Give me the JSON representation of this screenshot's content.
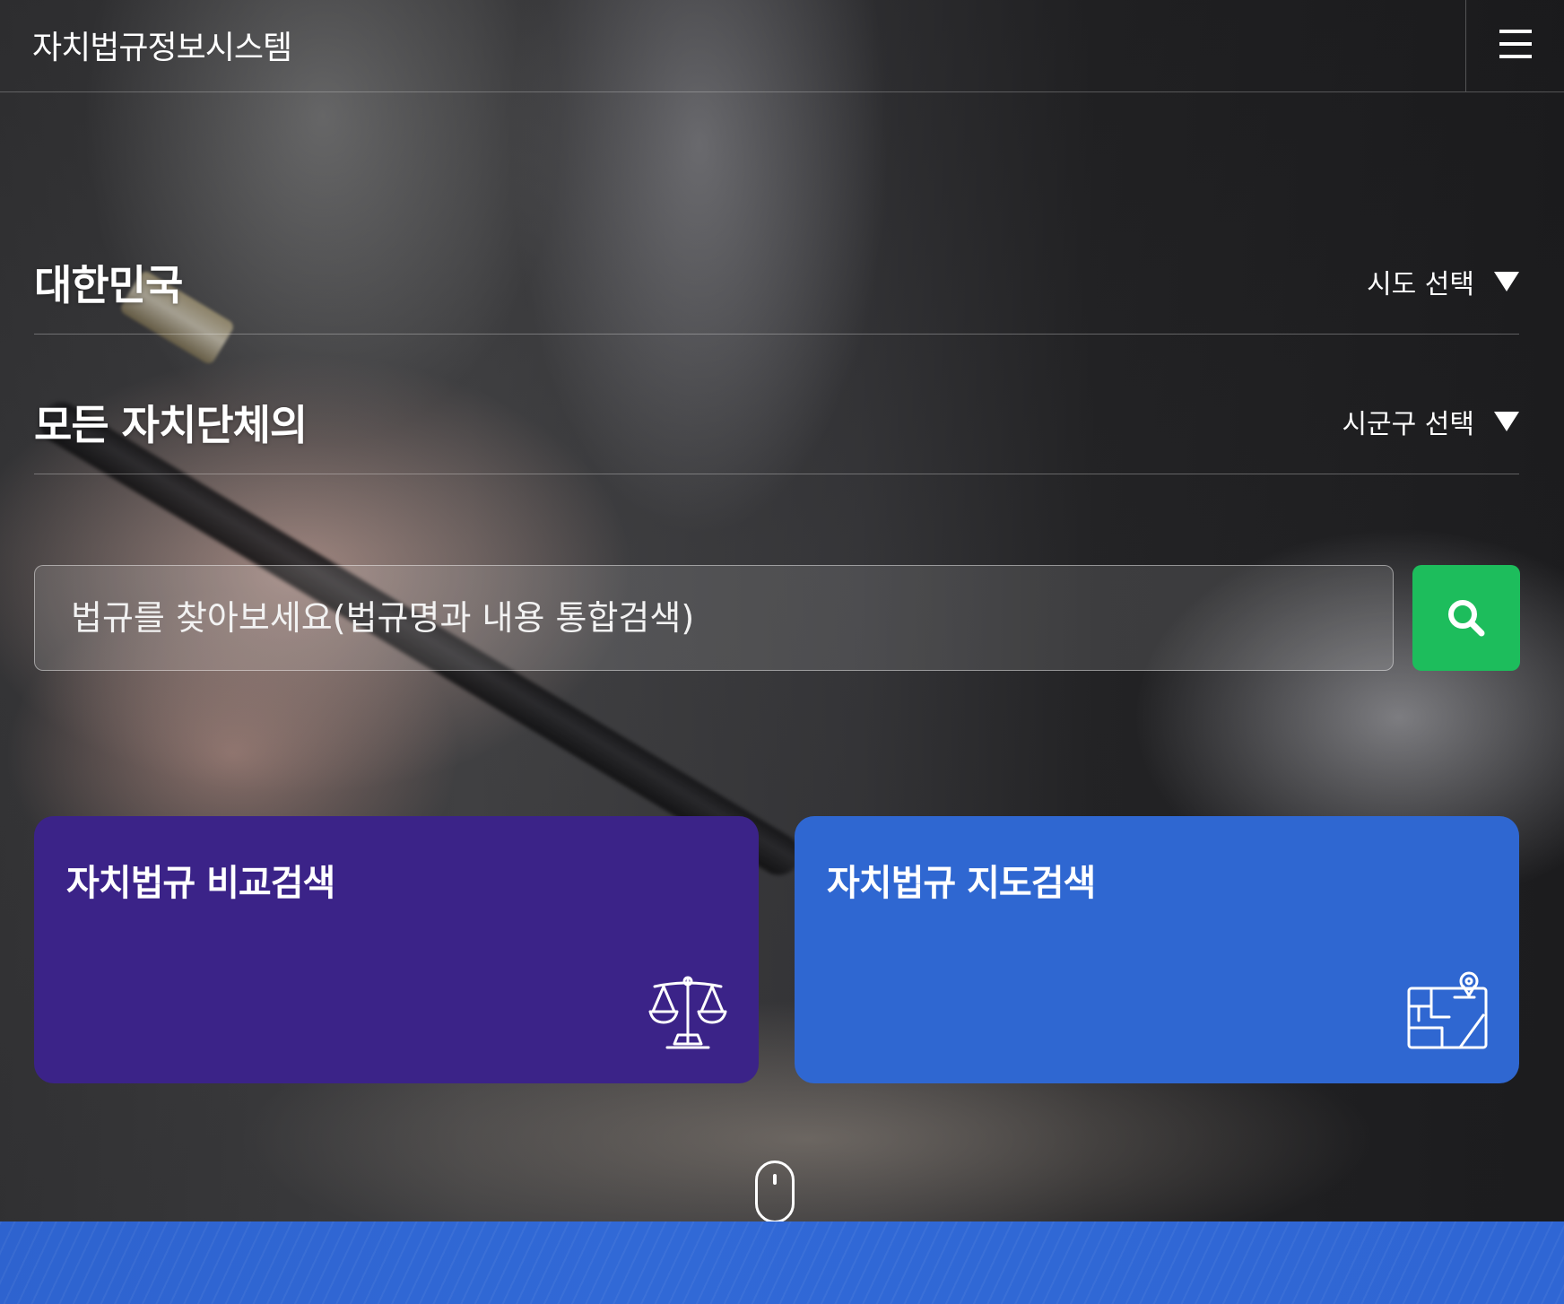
{
  "header": {
    "site_title": "자치법규정보시스템",
    "menu_icon": "hamburger-menu-icon"
  },
  "region": {
    "country_label": "대한민국",
    "province_select_label": "시도 선택",
    "all_local_govs_label": "모든 자치단체의",
    "district_select_label": "시군구 선택"
  },
  "search": {
    "placeholder": "법규를 찾아보세요(법규명과 내용 통합검색)",
    "button_icon": "search-icon",
    "button_color": "#1dbd5c"
  },
  "cards": {
    "compare": {
      "title": "자치법규 비교검색",
      "icon": "scales-icon",
      "color": "#3b2388"
    },
    "map": {
      "title": "자치법규 지도검색",
      "icon": "map-pin-icon",
      "color": "#2f67d1"
    }
  },
  "scroll_indicator": {
    "icon": "mouse-scroll-icon"
  }
}
